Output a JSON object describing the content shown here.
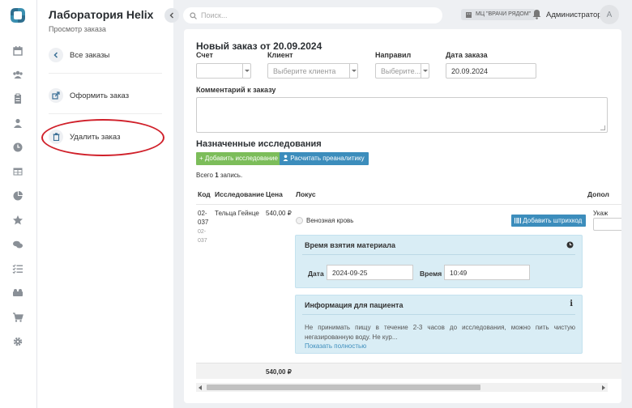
{
  "app": {
    "title": "Лаборатория Helix",
    "subtitle": "Просмотр заказа"
  },
  "sidebar": {
    "back": "Все заказы",
    "items": [
      {
        "label": "Оформить заказ",
        "icon": "external-link-icon"
      },
      {
        "label": "Удалить заказ",
        "icon": "trash-icon"
      }
    ]
  },
  "rail_icons": [
    "logo-icon",
    "calendar-icon",
    "users-icon",
    "clipboard-icon",
    "user-icon",
    "clock-icon",
    "table-icon",
    "pie-chart-icon",
    "star-icon",
    "chat-icon",
    "checklist-icon",
    "group-icon",
    "cart-icon",
    "gear-icon"
  ],
  "topbar": {
    "search_placeholder": "Поиск...",
    "clinic": "МЦ \"ВРАЧИ РЯДОМ\"",
    "user": "Администратор",
    "avatar": "A"
  },
  "order": {
    "title": "Новый заказ от 20.09.2024",
    "labels": {
      "account": "Счет",
      "client": "Клиент",
      "referrer": "Направил",
      "date": "Дата заказа",
      "comment": "Комментарий к заказу"
    },
    "values": {
      "account": "",
      "client_placeholder": "Выберите клиента",
      "referrer_placeholder": "Выберите...",
      "date": "20.09.2024"
    }
  },
  "studies": {
    "title": "Назначенные исследования",
    "add_btn": "+ Добавить исследование",
    "calc_btn": "Расчитать преаналитику",
    "count_prefix": "Всего ",
    "count": "1",
    "count_suffix": " запись.",
    "columns": [
      "Код",
      "Исследование",
      "Цена",
      "Локус",
      "Допол"
    ],
    "row": {
      "code1": "02-",
      "code2": "037",
      "code_sub1": "02-",
      "code_sub2": "037",
      "name": "Тельца Гейнце",
      "price": "540,00 ₽",
      "locus": "Венозная кровь",
      "barcode_btn": "Добавить штрихкод",
      "extra": "Укаж"
    },
    "sampling": {
      "title": "Время взятия материала",
      "date_label": "Дата",
      "date": "2024-09-25",
      "time_label": "Время",
      "time": "10:49"
    },
    "patient_info": {
      "title": "Информация для пациента",
      "text": "Не принимать пищу в течение 2-3 часов до исследования, можно пить чистую негазированную воду. Не кур...",
      "link": "Показать полностью"
    },
    "total": "540,00 ₽"
  },
  "colors": {
    "accent": "#3c8dbc",
    "green": "#7cbd5a",
    "panel": "#d9edf5",
    "annotation": "#d0202a"
  }
}
